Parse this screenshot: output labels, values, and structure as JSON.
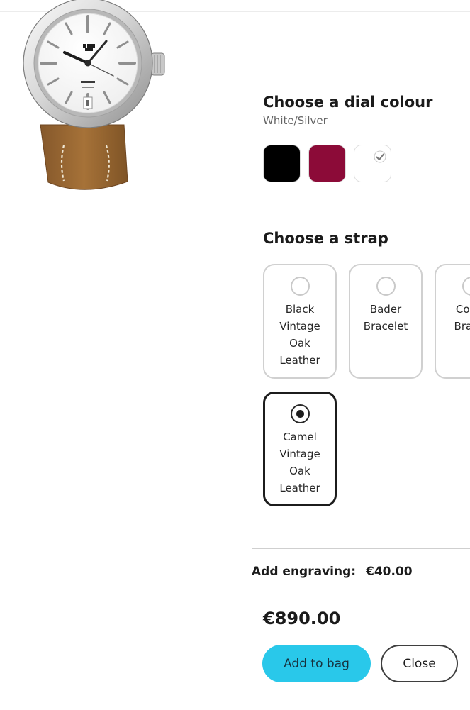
{
  "dial": {
    "title": "Choose a dial colour",
    "selected_name": "White/Silver",
    "swatches": [
      {
        "color": "#000000",
        "selected": false
      },
      {
        "color": "#8c0b38",
        "selected": false
      },
      {
        "color": "#ffffff",
        "selected": true
      }
    ]
  },
  "strap": {
    "title": "Choose a strap",
    "options": [
      {
        "label": "Black Vintage Oak Leather",
        "selected": false
      },
      {
        "label": "Bader Bracelet",
        "selected": false
      },
      {
        "label": "Con… Brac…",
        "selected": false
      },
      {
        "label": "Camel Vintage Oak Leather",
        "selected": true
      }
    ]
  },
  "engraving": {
    "label": "Add engraving:",
    "price": "€40.00"
  },
  "price": "€890.00",
  "buttons": {
    "add_to_bag": "Add to bag",
    "close": "Close"
  },
  "colors": {
    "accent": "#29c8ea",
    "leather": "#9c6b35",
    "divider": "#cfcfcf"
  },
  "icons": {
    "watch_image": "watch-image",
    "selected_swatch": "check-icon"
  }
}
